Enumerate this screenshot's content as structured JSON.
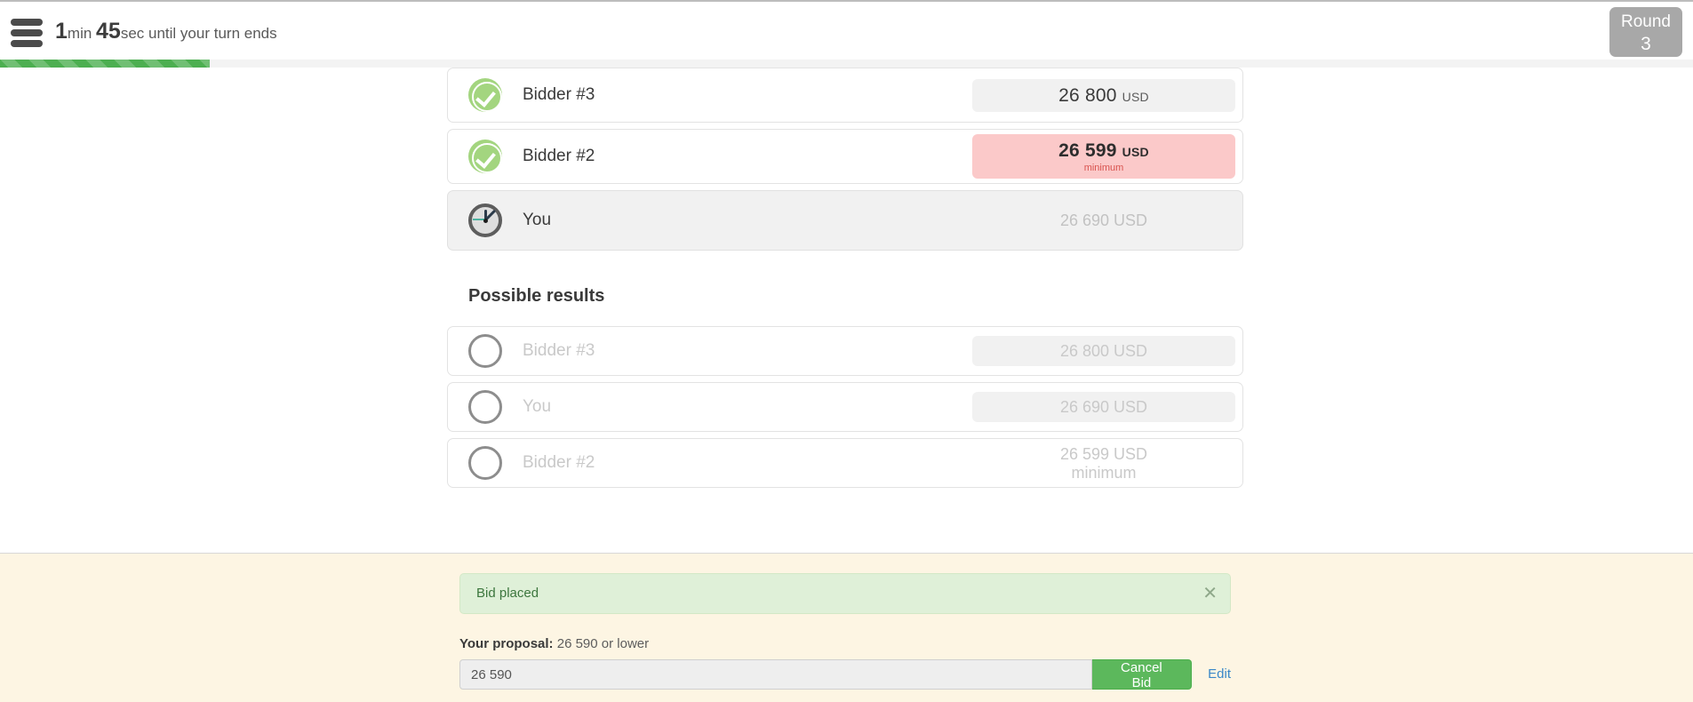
{
  "header": {
    "menu_icon": "hamburger-icon",
    "timer_minutes": "1",
    "timer_minutes_unit": "min ",
    "timer_seconds": "45",
    "timer_seconds_unit": "sec until your turn ends",
    "round_label": "Round",
    "round_number": "3",
    "progress_percent": 12.4,
    "progress_color": "#4caf50"
  },
  "current_bids": {
    "rows": [
      {
        "icon": "check-circle-icon",
        "name": "Bidder #3",
        "amount": "26 800",
        "currency": "USD",
        "note": "",
        "pill_style": "grey"
      },
      {
        "icon": "check-circle-icon",
        "name": "Bidder #2",
        "amount": "26 599",
        "currency": "USD",
        "note": "minimum",
        "pill_style": "red"
      },
      {
        "icon": "clock-icon",
        "name": "You",
        "amount": "26 690 USD",
        "currency": "",
        "note": "",
        "pill_style": "none"
      }
    ]
  },
  "possible_results": {
    "heading": "Possible results",
    "rows": [
      {
        "icon": "empty-circle-icon",
        "name": "Bidder #3",
        "amount": "26 800 USD",
        "note": "",
        "pill_style": "grey"
      },
      {
        "icon": "empty-circle-icon",
        "name": "You",
        "amount": "26 690 USD",
        "note": "",
        "pill_style": "grey"
      },
      {
        "icon": "empty-circle-icon",
        "name": "Bidder #2",
        "amount": "26 599 USD",
        "note": "minimum",
        "pill_style": "plain"
      }
    ]
  },
  "bottom": {
    "alert_text": "Bid placed",
    "alert_close_icon": "close-icon",
    "alert_color": "#dff0d8",
    "proposal_label": "Your proposal:",
    "proposal_hint": "26 590 or lower",
    "input_value": "26 590",
    "input_placeholder": "26 590",
    "cancel_button_label": "Cancel Bid",
    "cancel_button_color": "#5cb85c",
    "edit_link_label": "Edit",
    "edit_link_color": "#3a87c8"
  }
}
